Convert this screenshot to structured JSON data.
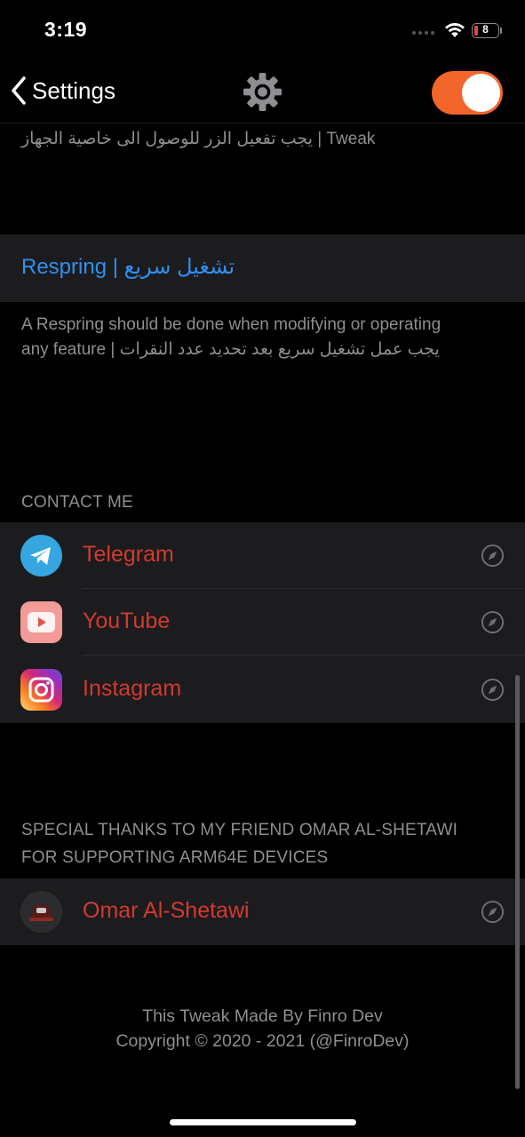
{
  "status_bar": {
    "time": "3:19",
    "battery_level": "8"
  },
  "nav": {
    "back_label": "Settings",
    "enabled_toggle_on": true
  },
  "top_footnote": "يجب تفعيل الزر للوصول الى خاصية الجهاز | Tweak",
  "respring": {
    "label": "Respring | تشغيل سريع",
    "footnote_line1": "A Respring should be done when modifying or operating",
    "footnote_line2": "any feature | يجب عمل تشغيل سريع بعد تحديد عدد النقرات"
  },
  "contact": {
    "header": "CONTACT ME",
    "items": [
      {
        "label": "Telegram",
        "icon": "telegram-icon"
      },
      {
        "label": "YouTube",
        "icon": "youtube-icon"
      },
      {
        "label": "Instagram",
        "icon": "instagram-icon"
      }
    ]
  },
  "thanks": {
    "header_line1": "SPECIAL THANKS TO MY FRIEND OMAR AL-SHETAWI",
    "header_line2": "FOR SUPPORTING ARM64E DEVICES",
    "person": {
      "label": "Omar Al-Shetawi",
      "icon": "avatar"
    }
  },
  "credits": {
    "line1": "This Tweak Made By Finro Dev",
    "line2": "Copyright © 2020 - 2021 (@FinroDev)"
  },
  "colors": {
    "background": "#000000",
    "cell": "#1c1c1e",
    "link_blue": "#2f8ff0",
    "link_red": "#d23a2f",
    "toggle_on": "#f2662b",
    "secondary_text": "#8e8e93"
  }
}
